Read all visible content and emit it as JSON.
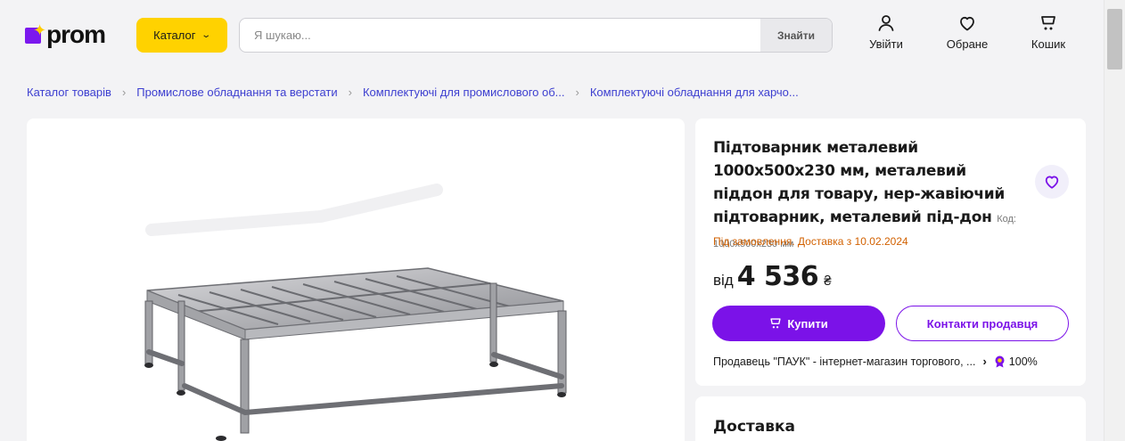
{
  "header": {
    "logo_text": "prom",
    "catalog_label": "Каталог",
    "search_placeholder": "Я шукаю...",
    "search_button": "Знайти",
    "login_label": "Увійти",
    "favorites_label": "Обране",
    "cart_label": "Кошик"
  },
  "breadcrumbs": [
    "Каталог товарів",
    "Промислове обладнання та верстати",
    "Комплектуючі для промислового об...",
    "Комплектуючі обладнання для харчо..."
  ],
  "product": {
    "title": "Підтоварник металевий 1000х500х230 мм, металевий піддон для товару, нер-жавіючий підтоварник, металевий під-дон",
    "code": "Код: 1000х500х230 мм",
    "availability": "Під замовлення. Доставка з 10.02.2024",
    "price_prefix": "від",
    "price_value": "4 536",
    "currency": "₴",
    "buy_label": "Купити",
    "contact_label": "Контакти продавця",
    "seller_text": "Продавець \"ПАУК\" - інтернет-магазин торгового, ...",
    "seller_rating": "100%"
  },
  "delivery": {
    "title": "Доставка"
  },
  "colors": {
    "brand_purple": "#7b12e8",
    "brand_yellow": "#ffd200",
    "link_blue": "#3d3fd0",
    "availability_orange": "#d26100"
  },
  "icons": {
    "login": "user-icon",
    "favorites": "heart-icon",
    "cart": "cart-icon",
    "catalog": "chevron-down-icon",
    "seller_badge": "rating-badge-icon"
  }
}
